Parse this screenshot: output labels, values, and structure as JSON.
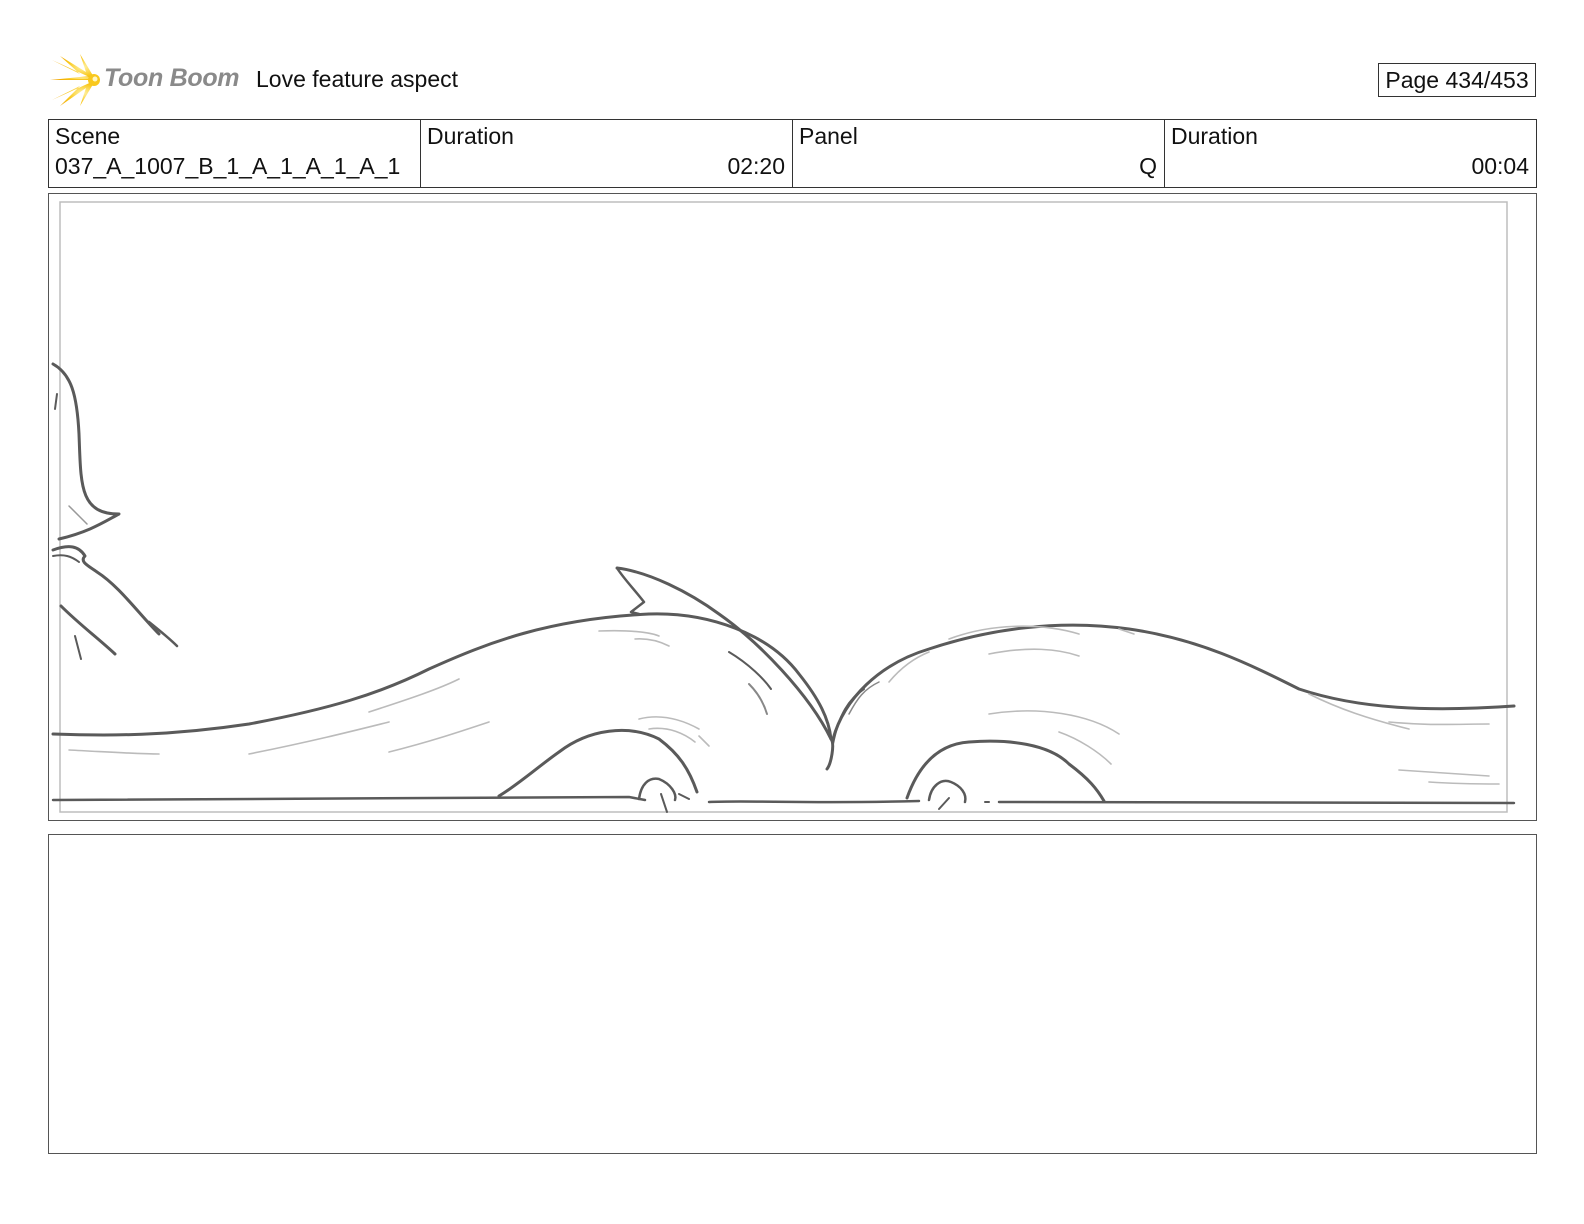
{
  "header": {
    "logo_icon": "toon-boom-star-logo",
    "logo_text": "Toon Boom",
    "project_title": "Love feature aspect",
    "page_indicator": "Page 434/453"
  },
  "info": {
    "scene_label": "Scene",
    "scene_value": "037_A_1007_B_1_A_1_A_1_A_1",
    "scene_duration_label": "Duration",
    "scene_duration_value": "02:20",
    "panel_label": "Panel",
    "panel_value": "Q",
    "panel_duration_label": "Duration",
    "panel_duration_value": "00:04"
  },
  "panel_image": "pencil-sketch-of-curved-landscape-with-character-edge",
  "colors": {
    "logo_yellow": "#f7c21a",
    "logo_text_gray": "#8a8a8a",
    "sketch_stroke": "#555555"
  }
}
